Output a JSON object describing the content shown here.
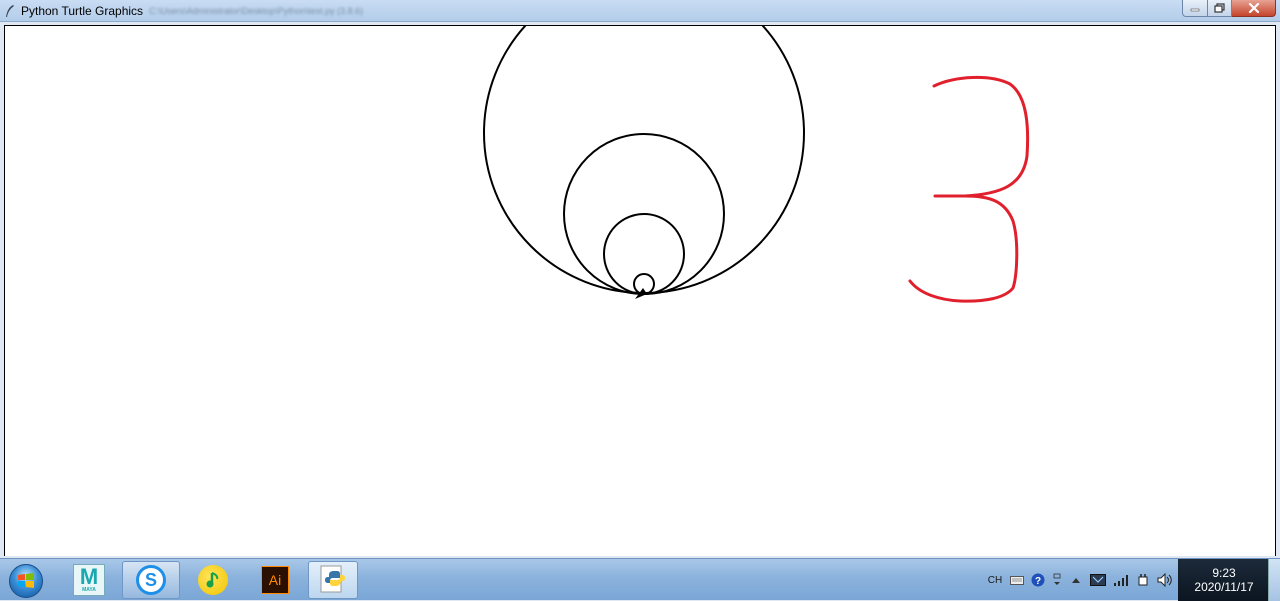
{
  "window": {
    "title": "Python Turtle Graphics",
    "path_blurred": "C:\\Users\\Administrator\\Desktop\\Python\\test.py (3.8.6)"
  },
  "canvas": {
    "drawing": {
      "circles": {
        "stroke": "#000000"
      },
      "digit": {
        "text": "3",
        "stroke": "#e0202c"
      }
    }
  },
  "taskbar": {
    "apps": [
      {
        "name": "Maya",
        "icon": "maya-icon",
        "label": "MAYA"
      },
      {
        "name": "Sogou",
        "icon": "sogou-icon"
      },
      {
        "name": "QQ Music",
        "icon": "qq-music-icon"
      },
      {
        "name": "Illustrator",
        "icon": "illustrator-icon",
        "label": "Ai"
      },
      {
        "name": "Python",
        "icon": "python-icon"
      }
    ],
    "tray": {
      "ime": "CH",
      "time": "9:23",
      "date": "2020/11/17"
    }
  }
}
